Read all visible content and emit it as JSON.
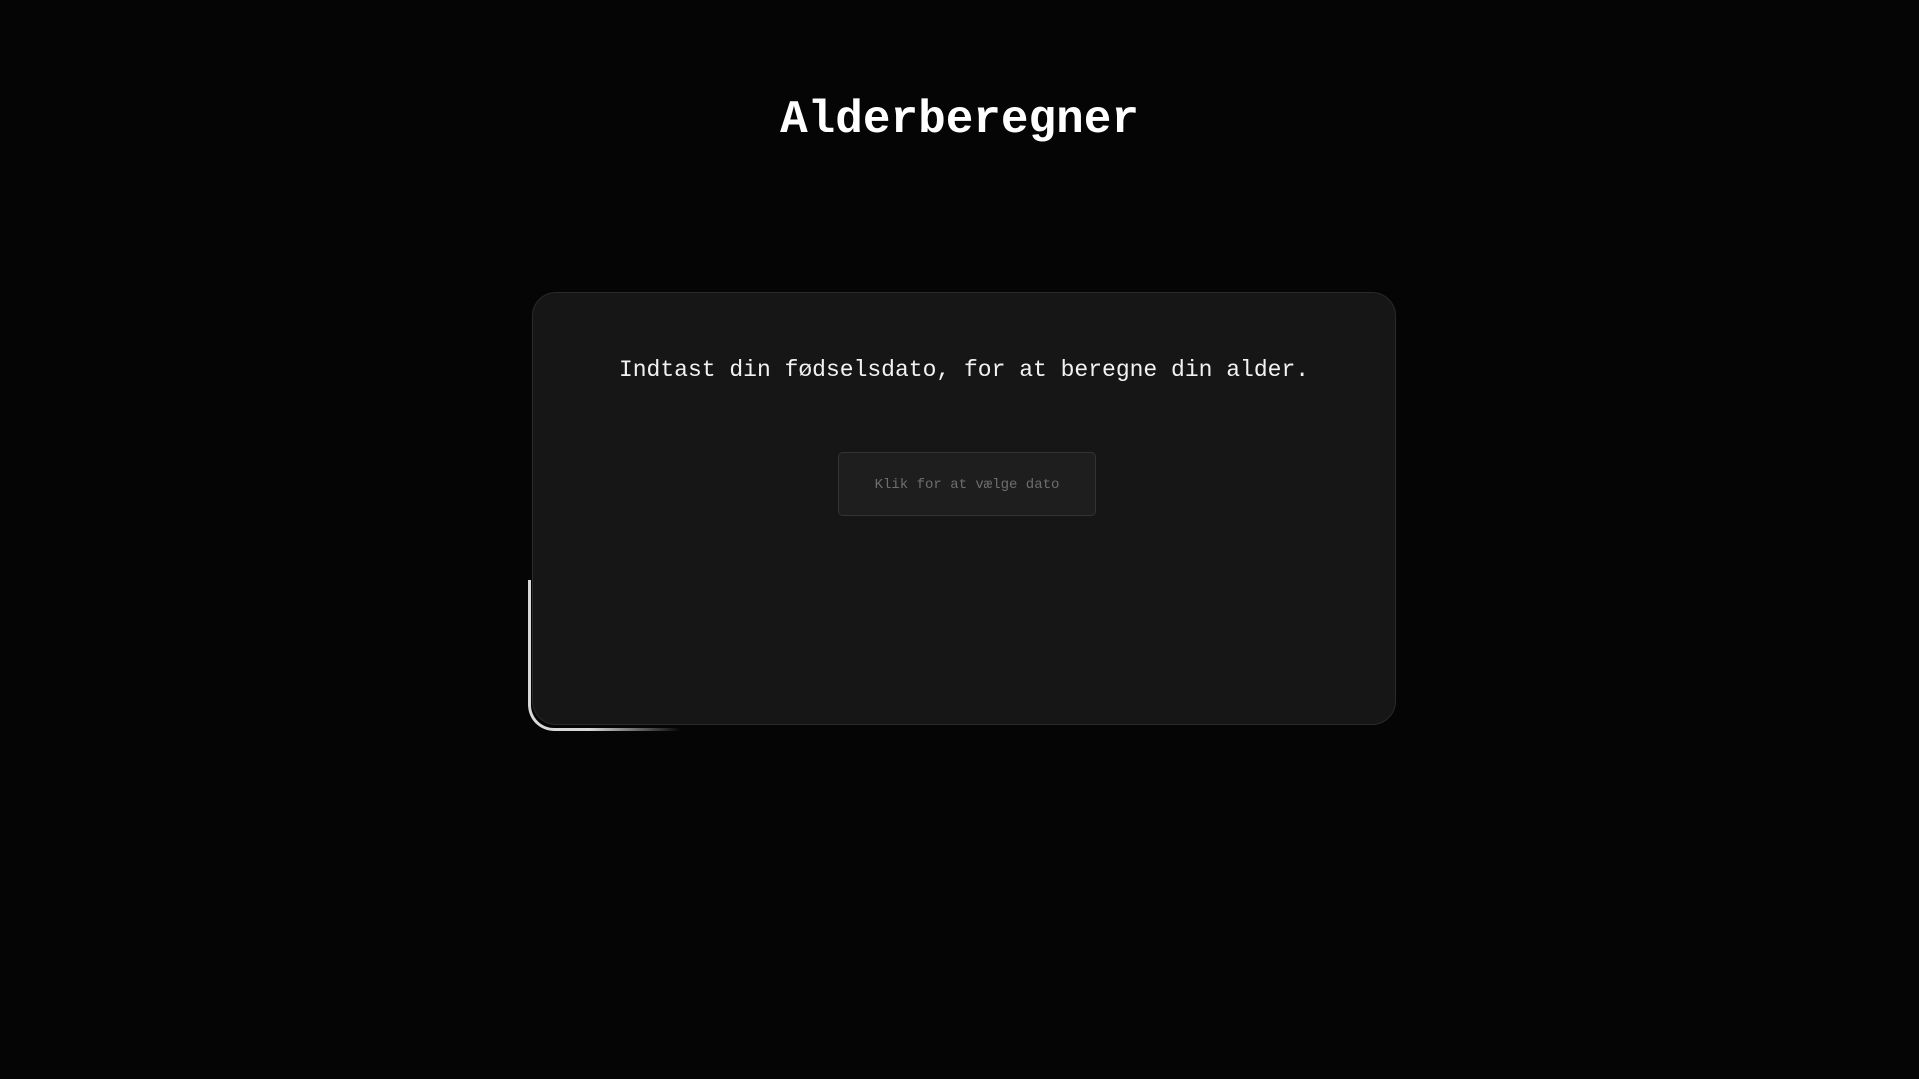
{
  "page": {
    "title": "Alderberegner",
    "background_color": "#050505"
  },
  "card": {
    "prompt": "Indtast din fødselsdato, for at beregne din alder.",
    "date_button_label": "Klik for at vælge dato",
    "background_color": "#161616"
  }
}
